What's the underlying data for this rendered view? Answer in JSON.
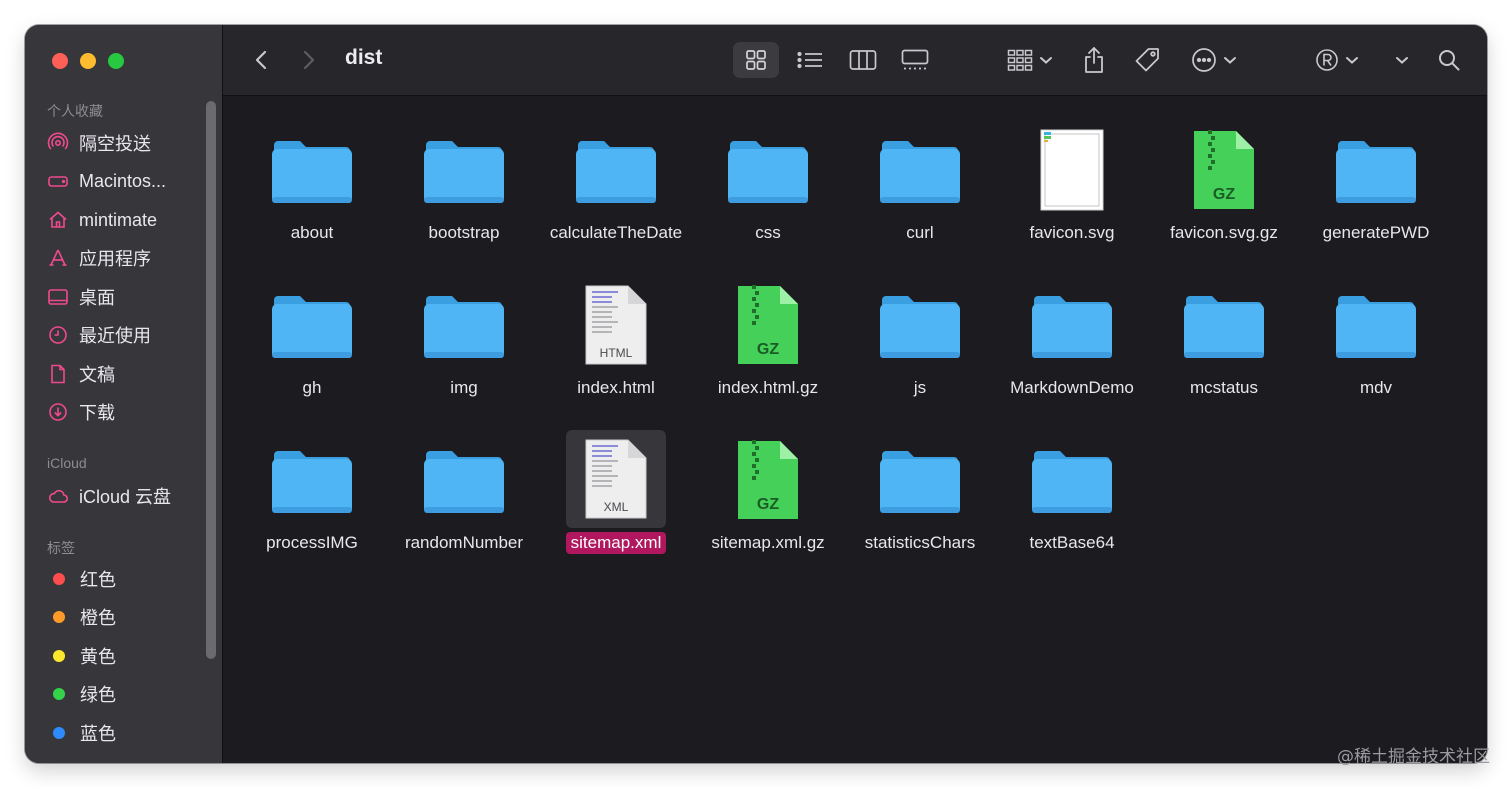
{
  "window": {
    "title": "dist"
  },
  "sidebar": {
    "favorites_header": "个人收藏",
    "favorites": [
      {
        "label": "隔空投送",
        "icon": "airdrop-icon"
      },
      {
        "label": "Macintos...",
        "icon": "hard-drive-icon"
      },
      {
        "label": "mintimate",
        "icon": "home-icon"
      },
      {
        "label": "应用程序",
        "icon": "applications-icon"
      },
      {
        "label": "桌面",
        "icon": "desktop-icon"
      },
      {
        "label": "最近使用",
        "icon": "clock-icon"
      },
      {
        "label": "文稿",
        "icon": "document-icon"
      },
      {
        "label": "下载",
        "icon": "download-icon"
      }
    ],
    "icloud_header": "iCloud",
    "icloud": [
      {
        "label": "iCloud 云盘",
        "icon": "cloud-icon"
      }
    ],
    "tags_header": "标签",
    "tags": [
      {
        "label": "红色",
        "color": "#fe4d4d"
      },
      {
        "label": "橙色",
        "color": "#fd9a28"
      },
      {
        "label": "黄色",
        "color": "#fee82b"
      },
      {
        "label": "绿色",
        "color": "#34d34a"
      },
      {
        "label": "蓝色",
        "color": "#2d8bfd"
      }
    ]
  },
  "toolbar": {
    "icons": [
      "back-icon",
      "forward-icon",
      "icon-view-icon",
      "list-view-icon",
      "column-view-icon",
      "gallery-view-icon",
      "group-icon",
      "share-icon",
      "tag-icon",
      "more-icon",
      "registered-icon",
      "chevron-down-icon",
      "search-icon"
    ],
    "active_view": "icon-view"
  },
  "files": [
    {
      "name": "about",
      "kind": "folder"
    },
    {
      "name": "bootstrap",
      "kind": "folder"
    },
    {
      "name": "calculateTheDate",
      "kind": "folder"
    },
    {
      "name": "css",
      "kind": "folder"
    },
    {
      "name": "curl",
      "kind": "folder"
    },
    {
      "name": "favicon.svg",
      "kind": "svg"
    },
    {
      "name": "favicon.svg.gz",
      "kind": "gz"
    },
    {
      "name": "generatePWD",
      "kind": "folder"
    },
    {
      "name": "gh",
      "kind": "folder"
    },
    {
      "name": "img",
      "kind": "folder"
    },
    {
      "name": "index.html",
      "kind": "html"
    },
    {
      "name": "index.html.gz",
      "kind": "gz"
    },
    {
      "name": "js",
      "kind": "folder"
    },
    {
      "name": "MarkdownDemo",
      "kind": "folder"
    },
    {
      "name": "mcstatus",
      "kind": "folder"
    },
    {
      "name": "mdv",
      "kind": "folder"
    },
    {
      "name": "processIMG",
      "kind": "folder"
    },
    {
      "name": "randomNumber",
      "kind": "folder"
    },
    {
      "name": "sitemap.xml",
      "kind": "xml",
      "selected": true
    },
    {
      "name": "sitemap.xml.gz",
      "kind": "gz"
    },
    {
      "name": "statisticsChars",
      "kind": "folder"
    },
    {
      "name": "textBase64",
      "kind": "folder"
    }
  ],
  "file_badges": {
    "gz": "GZ",
    "html": "HTML",
    "xml": "XML"
  },
  "watermark": "@稀土掘金技术社区"
}
